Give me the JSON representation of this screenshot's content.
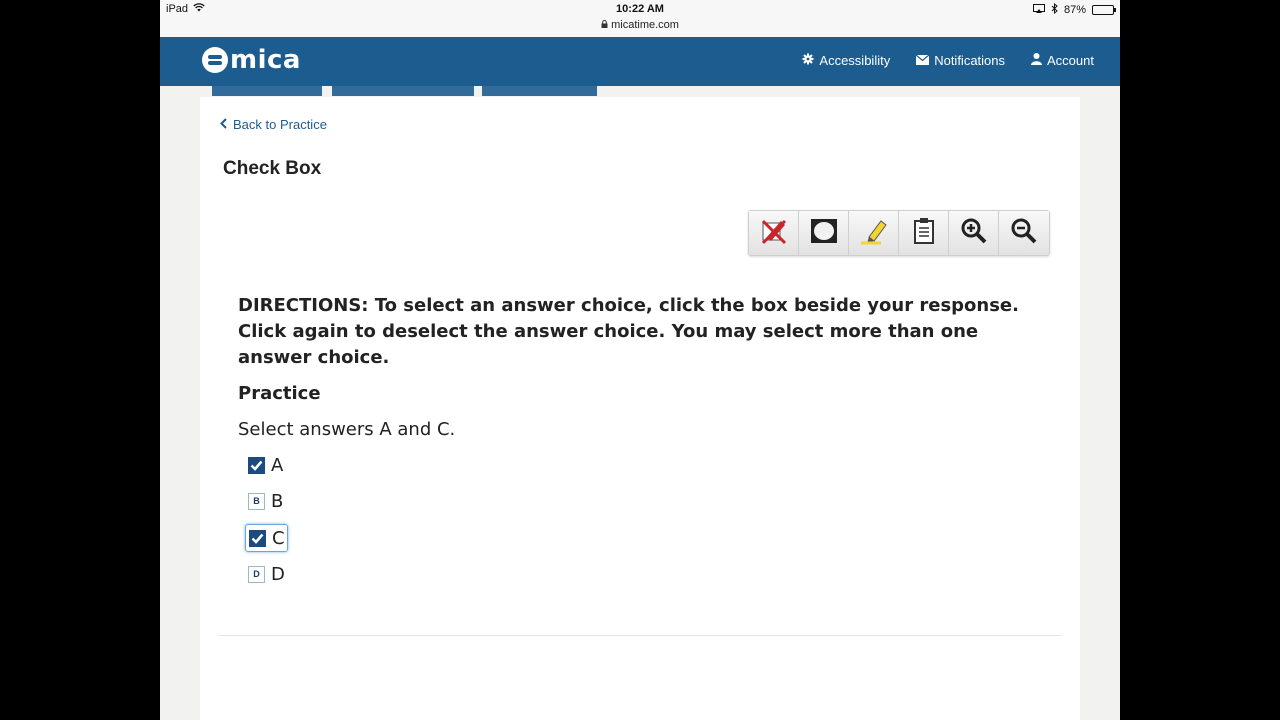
{
  "status_bar": {
    "device": "iPad",
    "time": "10:22 AM",
    "url": "micatime.com",
    "battery": "87%",
    "battery_level": 0.87
  },
  "header": {
    "logo_text": "mica",
    "nav": [
      {
        "label": "Accessibility",
        "icon": "gear-icon"
      },
      {
        "label": "Notifications",
        "icon": "envelope-icon"
      },
      {
        "label": "Account",
        "icon": "user-icon"
      }
    ],
    "color": "#1d5c8f"
  },
  "page": {
    "back_link": "Back to Practice",
    "title": "Check Box"
  },
  "toolbar": {
    "tools": [
      "eliminator-icon",
      "masking-icon",
      "highlighter-icon",
      "notepad-icon",
      "zoom-in-icon",
      "zoom-out-icon"
    ]
  },
  "question": {
    "directions": "DIRECTIONS: To select an answer choice, click the box beside your response. Click again to deselect the answer choice. You may select more than one answer choice.",
    "section": "Practice",
    "prompt": "Select answers A and C.",
    "options": [
      {
        "letter": "A",
        "label": "A",
        "checked": true
      },
      {
        "letter": "B",
        "label": "B",
        "checked": false
      },
      {
        "letter": "C",
        "label": "C",
        "checked": true,
        "focused": true
      },
      {
        "letter": "D",
        "label": "D",
        "checked": false
      }
    ]
  }
}
